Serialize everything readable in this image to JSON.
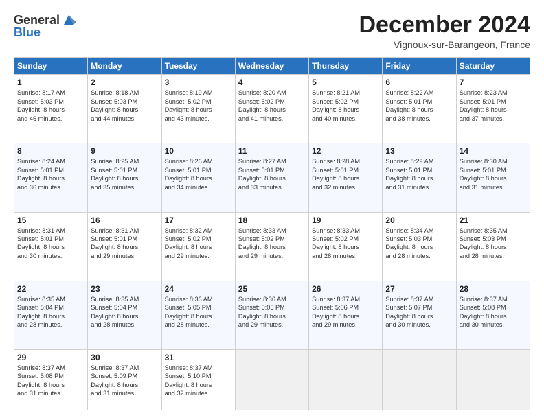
{
  "header": {
    "logo_line1": "General",
    "logo_line2": "Blue",
    "month": "December 2024",
    "location": "Vignoux-sur-Barangeon, France"
  },
  "days_of_week": [
    "Sunday",
    "Monday",
    "Tuesday",
    "Wednesday",
    "Thursday",
    "Friday",
    "Saturday"
  ],
  "weeks": [
    [
      {
        "day": "1",
        "text": "Sunrise: 8:17 AM\nSunset: 5:03 PM\nDaylight: 8 hours\nand 46 minutes."
      },
      {
        "day": "2",
        "text": "Sunrise: 8:18 AM\nSunset: 5:03 PM\nDaylight: 8 hours\nand 44 minutes."
      },
      {
        "day": "3",
        "text": "Sunrise: 8:19 AM\nSunset: 5:02 PM\nDaylight: 8 hours\nand 43 minutes."
      },
      {
        "day": "4",
        "text": "Sunrise: 8:20 AM\nSunset: 5:02 PM\nDaylight: 8 hours\nand 41 minutes."
      },
      {
        "day": "5",
        "text": "Sunrise: 8:21 AM\nSunset: 5:02 PM\nDaylight: 8 hours\nand 40 minutes."
      },
      {
        "day": "6",
        "text": "Sunrise: 8:22 AM\nSunset: 5:01 PM\nDaylight: 8 hours\nand 38 minutes."
      },
      {
        "day": "7",
        "text": "Sunrise: 8:23 AM\nSunset: 5:01 PM\nDaylight: 8 hours\nand 37 minutes."
      }
    ],
    [
      {
        "day": "8",
        "text": "Sunrise: 8:24 AM\nSunset: 5:01 PM\nDaylight: 8 hours\nand 36 minutes."
      },
      {
        "day": "9",
        "text": "Sunrise: 8:25 AM\nSunset: 5:01 PM\nDaylight: 8 hours\nand 35 minutes."
      },
      {
        "day": "10",
        "text": "Sunrise: 8:26 AM\nSunset: 5:01 PM\nDaylight: 8 hours\nand 34 minutes."
      },
      {
        "day": "11",
        "text": "Sunrise: 8:27 AM\nSunset: 5:01 PM\nDaylight: 8 hours\nand 33 minutes."
      },
      {
        "day": "12",
        "text": "Sunrise: 8:28 AM\nSunset: 5:01 PM\nDaylight: 8 hours\nand 32 minutes."
      },
      {
        "day": "13",
        "text": "Sunrise: 8:29 AM\nSunset: 5:01 PM\nDaylight: 8 hours\nand 31 minutes."
      },
      {
        "day": "14",
        "text": "Sunrise: 8:30 AM\nSunset: 5:01 PM\nDaylight: 8 hours\nand 31 minutes."
      }
    ],
    [
      {
        "day": "15",
        "text": "Sunrise: 8:31 AM\nSunset: 5:01 PM\nDaylight: 8 hours\nand 30 minutes."
      },
      {
        "day": "16",
        "text": "Sunrise: 8:31 AM\nSunset: 5:01 PM\nDaylight: 8 hours\nand 29 minutes."
      },
      {
        "day": "17",
        "text": "Sunrise: 8:32 AM\nSunset: 5:02 PM\nDaylight: 8 hours\nand 29 minutes."
      },
      {
        "day": "18",
        "text": "Sunrise: 8:33 AM\nSunset: 5:02 PM\nDaylight: 8 hours\nand 29 minutes."
      },
      {
        "day": "19",
        "text": "Sunrise: 8:33 AM\nSunset: 5:02 PM\nDaylight: 8 hours\nand 28 minutes."
      },
      {
        "day": "20",
        "text": "Sunrise: 8:34 AM\nSunset: 5:03 PM\nDaylight: 8 hours\nand 28 minutes."
      },
      {
        "day": "21",
        "text": "Sunrise: 8:35 AM\nSunset: 5:03 PM\nDaylight: 8 hours\nand 28 minutes."
      }
    ],
    [
      {
        "day": "22",
        "text": "Sunrise: 8:35 AM\nSunset: 5:04 PM\nDaylight: 8 hours\nand 28 minutes."
      },
      {
        "day": "23",
        "text": "Sunrise: 8:35 AM\nSunset: 5:04 PM\nDaylight: 8 hours\nand 28 minutes."
      },
      {
        "day": "24",
        "text": "Sunrise: 8:36 AM\nSunset: 5:05 PM\nDaylight: 8 hours\nand 28 minutes."
      },
      {
        "day": "25",
        "text": "Sunrise: 8:36 AM\nSunset: 5:05 PM\nDaylight: 8 hours\nand 29 minutes."
      },
      {
        "day": "26",
        "text": "Sunrise: 8:37 AM\nSunset: 5:06 PM\nDaylight: 8 hours\nand 29 minutes."
      },
      {
        "day": "27",
        "text": "Sunrise: 8:37 AM\nSunset: 5:07 PM\nDaylight: 8 hours\nand 30 minutes."
      },
      {
        "day": "28",
        "text": "Sunrise: 8:37 AM\nSunset: 5:08 PM\nDaylight: 8 hours\nand 30 minutes."
      }
    ],
    [
      {
        "day": "29",
        "text": "Sunrise: 8:37 AM\nSunset: 5:08 PM\nDaylight: 8 hours\nand 31 minutes."
      },
      {
        "day": "30",
        "text": "Sunrise: 8:37 AM\nSunset: 5:09 PM\nDaylight: 8 hours\nand 31 minutes."
      },
      {
        "day": "31",
        "text": "Sunrise: 8:37 AM\nSunset: 5:10 PM\nDaylight: 8 hours\nand 32 minutes."
      },
      {
        "day": "",
        "text": ""
      },
      {
        "day": "",
        "text": ""
      },
      {
        "day": "",
        "text": ""
      },
      {
        "day": "",
        "text": ""
      }
    ]
  ]
}
